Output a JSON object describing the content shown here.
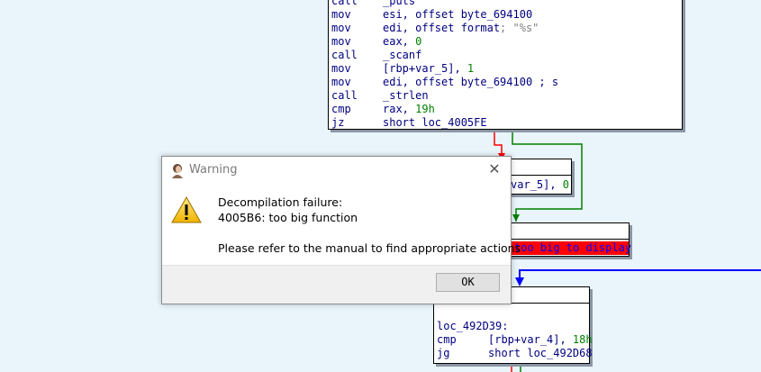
{
  "top_block": {
    "lines": [
      {
        "op": "call",
        "arg": "_puts",
        "num": "",
        "cmt": ""
      },
      {
        "op": "mov",
        "arg": "esi, offset byte_694100",
        "num": "",
        "cmt": ""
      },
      {
        "op": "mov",
        "arg": "edi, offset format",
        "num": "",
        "cmt": "; \"%s\""
      },
      {
        "op": "mov",
        "arg": "eax, ",
        "num": "0",
        "cmt": ""
      },
      {
        "op": "call",
        "arg": "_scanf",
        "num": "",
        "cmt": ""
      },
      {
        "op": "mov",
        "arg": "[rbp+var_5], ",
        "num": "1",
        "cmt": ""
      },
      {
        "op": "mov",
        "arg": "edi, offset byte_694100 ; s",
        "num": "",
        "cmt": ""
      },
      {
        "op": "call",
        "arg": "_strlen",
        "num": "",
        "cmt": ""
      },
      {
        "op": "cmp",
        "arg": "rax, ",
        "num": "19h",
        "cmt": ""
      },
      {
        "op": "jz",
        "arg": "short loc_4005FE",
        "num": "",
        "cmt": ""
      }
    ]
  },
  "mid_block": {
    "fragment": "var_5], ",
    "fragment_num": "0"
  },
  "error_block": {
    "text": "too big to display"
  },
  "bottom_block": {
    "label": "loc_492D39:",
    "lines": [
      {
        "op": "cmp",
        "arg": "[rbp+var_4], ",
        "num": "18h"
      },
      {
        "op": "jg",
        "arg": "short loc_492D68",
        "num": ""
      }
    ]
  },
  "dialog": {
    "title": "Warning",
    "close_symbol": "✕",
    "line1": "Decompilation failure:",
    "line2": "4005B6: too big function",
    "line3": "Please refer to the manual to find appropriate actions",
    "ok_label": "OK"
  },
  "colors": {
    "background": "#e9f4fb",
    "edge_red": "#ff0000",
    "edge_green": "#008000",
    "edge_blue": "#0000ff",
    "error_bg": "#ff0000",
    "error_text": "#0000ff"
  }
}
